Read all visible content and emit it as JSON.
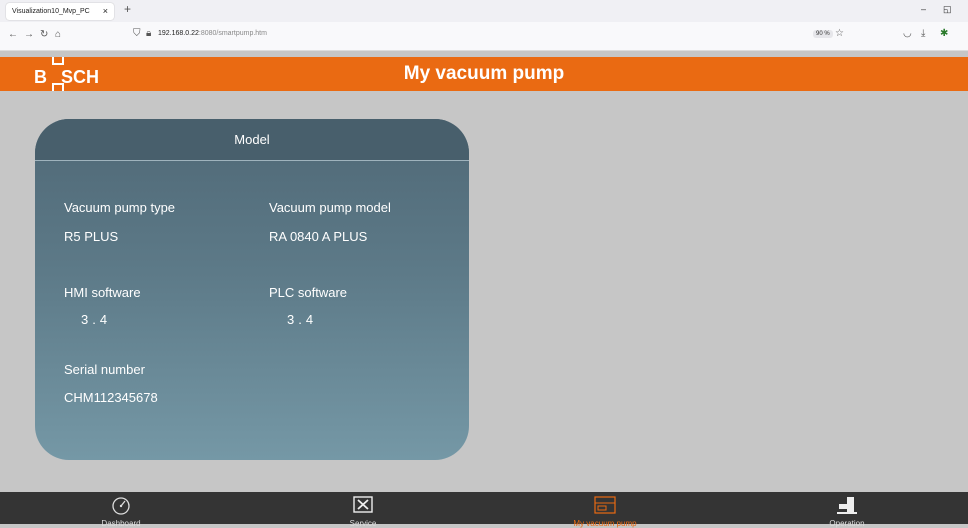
{
  "browser": {
    "tab_title": "Visualization10_Mvp_PC",
    "tab_close": "×",
    "new_tab": "+",
    "url_host": "192.168.0.22",
    "url_rest": ":8080/smartpump.htm",
    "zoom": "90 %",
    "minimize": "–",
    "restore": "◱"
  },
  "header": {
    "logo_text": "BSCH",
    "title": "My vacuum pump"
  },
  "card": {
    "title": "Model",
    "fields": {
      "pump_type_label": "Vacuum pump type",
      "pump_type_value": "R5 PLUS",
      "pump_model_label": "Vacuum pump model",
      "pump_model_value": "RA 0840 A PLUS",
      "hmi_label": "HMI software",
      "hmi_value": "3.4",
      "plc_label": "PLC software",
      "plc_value": "3.4",
      "serial_label": "Serial number",
      "serial_value": "CHM112345678"
    }
  },
  "bottom_nav": {
    "items": [
      {
        "label": "Dashboard",
        "icon": "gauge-icon",
        "color": "#dddddd"
      },
      {
        "label": "Service",
        "icon": "service-tools-icon",
        "color": "#dddddd"
      },
      {
        "label": "My vacuum pump",
        "icon": "pump-icon",
        "color": "#ea6a12"
      },
      {
        "label": "Operation",
        "icon": "operation-icon",
        "color": "#dddddd"
      }
    ]
  },
  "colors": {
    "brand": "#ea6a12",
    "background": "#c6c6c6",
    "card_header": "#485f6c",
    "nav_background": "#343434"
  }
}
